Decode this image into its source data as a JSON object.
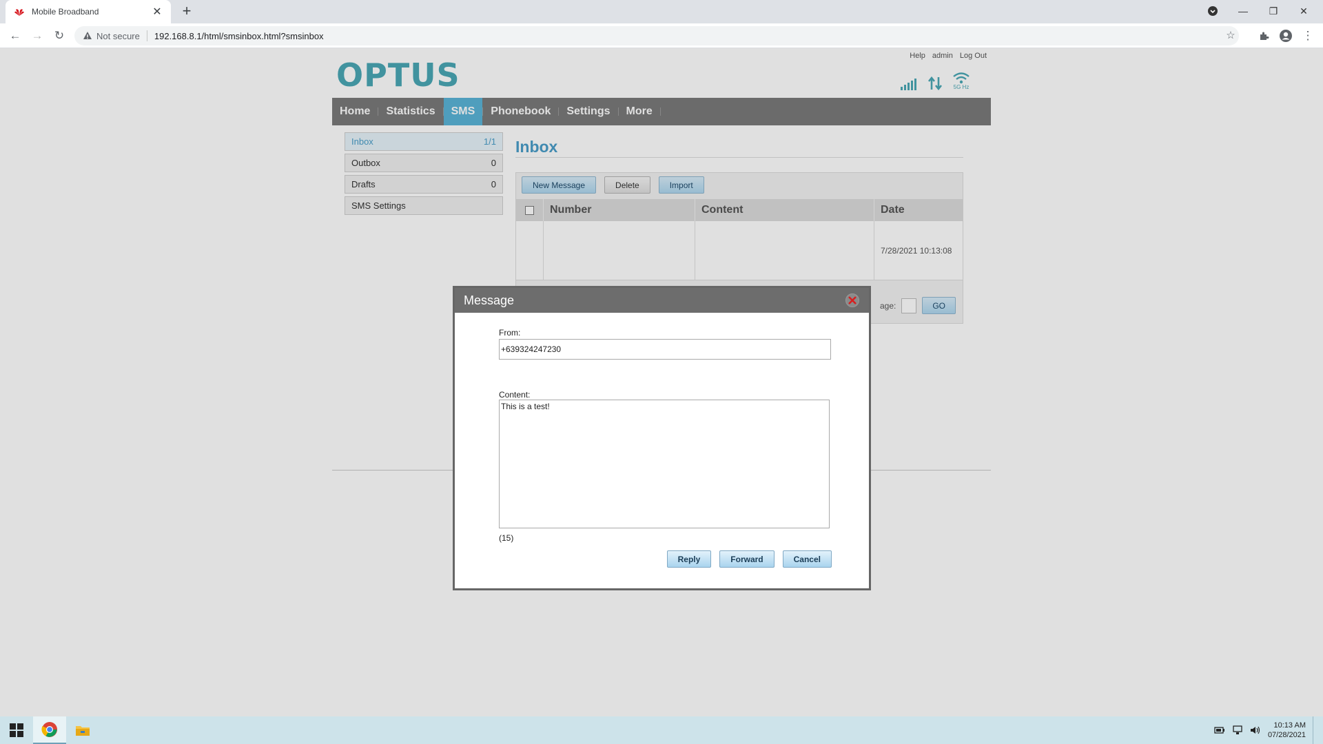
{
  "browser": {
    "tab_title": "Mobile Broadband",
    "security_label": "Not secure",
    "url": "192.168.8.1/html/smsinbox.html?smsinbox"
  },
  "header": {
    "logo": "OPTUS",
    "links": [
      "Help",
      "admin",
      "Log Out"
    ],
    "network_band": "5G Hz"
  },
  "nav": {
    "items": [
      "Home",
      "Statistics",
      "SMS",
      "Phonebook",
      "Settings",
      "More"
    ],
    "active": "SMS"
  },
  "sidebar": {
    "items": [
      {
        "label": "Inbox",
        "count": "1/1"
      },
      {
        "label": "Outbox",
        "count": "0"
      },
      {
        "label": "Drafts",
        "count": "0"
      },
      {
        "label": "SMS Settings",
        "count": ""
      }
    ]
  },
  "inbox": {
    "title": "Inbox",
    "buttons": {
      "new": "New Message",
      "delete": "Delete",
      "import": "Import"
    },
    "columns": [
      "Number",
      "Content",
      "Date"
    ],
    "row_date": "7/28/2021 10:13:08",
    "pager_label": "age:",
    "go": "GO"
  },
  "modal": {
    "title": "Message",
    "from_label": "From:",
    "from_value": "+639324247230",
    "content_label": "Content:",
    "content_value": "This is a test!",
    "counter": "(15)",
    "buttons": {
      "reply": "Reply",
      "forward": "Forward",
      "cancel": "Cancel"
    }
  },
  "taskbar": {
    "time": "10:13 AM",
    "date": "07/28/2021"
  },
  "colors": {
    "accent": "#4aa8b5",
    "nav_active": "#5ab4d8",
    "nav_bg": "#7a7a7a",
    "modal_head": "#6d6d6d"
  }
}
